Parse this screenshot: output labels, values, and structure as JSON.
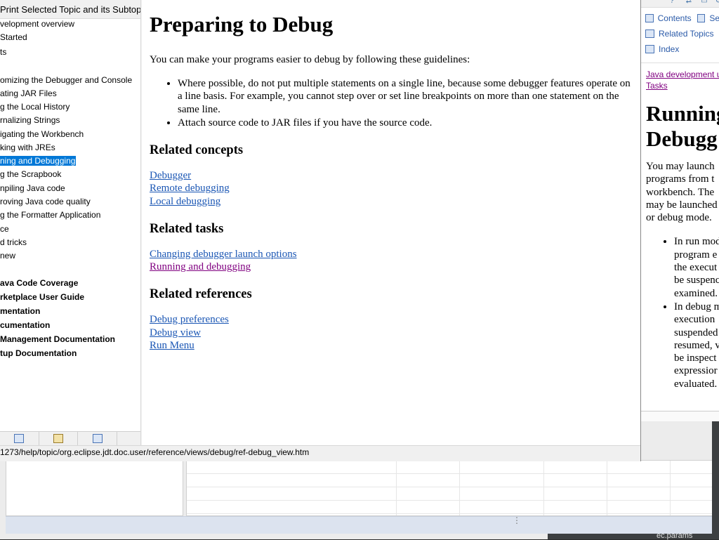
{
  "main_window": {
    "toc_header": "Print Selected Topic and its Subtopics",
    "toc_items": [
      {
        "label": "velopment overview",
        "selected": false,
        "bold": false
      },
      {
        "label": "Started",
        "selected": false,
        "bold": false
      },
      {
        "label": "ts",
        "selected": false,
        "bold": false
      },
      {
        "label": "omizing the Debugger and Console",
        "selected": false,
        "bold": false
      },
      {
        "label": "ating JAR Files",
        "selected": false,
        "bold": false
      },
      {
        "label": "g the Local History",
        "selected": false,
        "bold": false
      },
      {
        "label": "rnalizing Strings",
        "selected": false,
        "bold": false
      },
      {
        "label": "igating the Workbench",
        "selected": false,
        "bold": false
      },
      {
        "label": "king with JREs",
        "selected": false,
        "bold": false
      },
      {
        "label": "ning and Debugging",
        "selected": true,
        "bold": false
      },
      {
        "label": "g the Scrapbook",
        "selected": false,
        "bold": false
      },
      {
        "label": "npiling Java code",
        "selected": false,
        "bold": false
      },
      {
        "label": "roving Java code quality",
        "selected": false,
        "bold": false
      },
      {
        "label": "g the Formatter Application",
        "selected": false,
        "bold": false
      },
      {
        "label": "ce",
        "selected": false,
        "bold": false
      },
      {
        "label": "d tricks",
        "selected": false,
        "bold": false
      },
      {
        "label": "new",
        "selected": false,
        "bold": false
      },
      {
        "label": "ava Code Coverage",
        "selected": false,
        "bold": true
      },
      {
        "label": "rketplace User Guide",
        "selected": false,
        "bold": true
      },
      {
        "label": "mentation",
        "selected": false,
        "bold": true
      },
      {
        "label": "cumentation",
        "selected": false,
        "bold": true
      },
      {
        "label": "Management Documentation",
        "selected": false,
        "bold": true
      },
      {
        "label": "tup Documentation",
        "selected": false,
        "bold": true
      }
    ],
    "toc_tab_icons": [
      "contents-icon",
      "search-results-icon",
      "bookmarks-icon"
    ],
    "content": {
      "title": "Preparing to Debug",
      "intro": "You can make your programs easier to debug by following these guidelines:",
      "guidelines": [
        "Where possible, do not put multiple statements on a single line, because some debugger features operate on a line basis. For example, you cannot step over or set line breakpoints on more than one statement on the same line.",
        "Attach source code to JAR files if you have the source code."
      ],
      "sections": [
        {
          "heading": "Related concepts",
          "links": [
            {
              "label": "Debugger",
              "visited": false
            },
            {
              "label": "Remote debugging",
              "visited": false
            },
            {
              "label": "Local debugging",
              "visited": false
            }
          ]
        },
        {
          "heading": "Related tasks",
          "links": [
            {
              "label": "Changing debugger launch options",
              "visited": false
            },
            {
              "label": "Running and debugging",
              "visited": true
            }
          ]
        },
        {
          "heading": "Related references",
          "links": [
            {
              "label": "Debug preferences",
              "visited": false
            },
            {
              "label": "Debug view",
              "visited": false
            },
            {
              "label": "Run Menu",
              "visited": false
            }
          ]
        }
      ]
    },
    "status_url": "1273/help/topic/org.eclipse.jdt.doc.user/reference/views/debug/ref-debug_view.htm"
  },
  "right_window": {
    "tabs": [
      "Contents",
      "Se",
      "Related Topics",
      "Index"
    ],
    "breadcrumb": [
      "Java development u",
      "Tasks"
    ],
    "title_lines": [
      "Running",
      "Debugg"
    ],
    "paragraph_lines": [
      "You may launch",
      "programs from t",
      "workbench.  The",
      "may be launched",
      "or debug mode."
    ],
    "list_items": [
      [
        "In run mod",
        "program e",
        "the execut",
        "be suspenc",
        "examined."
      ],
      [
        "In debug m",
        "execution",
        "suspended",
        "resumed, v",
        "be inspect",
        "expressior",
        "evaluated."
      ]
    ]
  },
  "background": {
    "params_label": "ec.params"
  },
  "colors": {
    "link": "#1a56b4",
    "visited_link": "#800080",
    "selection": "#0078d7"
  }
}
